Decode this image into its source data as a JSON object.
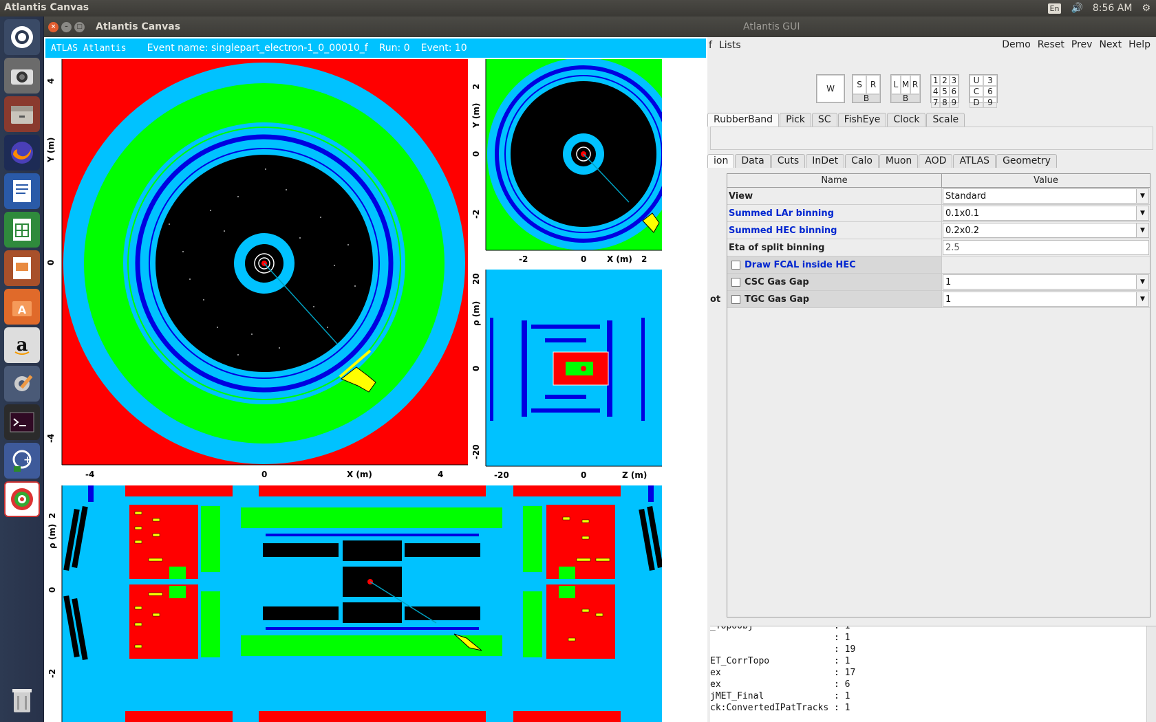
{
  "top_panel": {
    "title": "Atlantis Canvas",
    "keyboard": "En",
    "time": "8:56 AM"
  },
  "launcher": {
    "items": [
      "ubuntu-dash-icon",
      "camera-icon",
      "files-icon",
      "firefox-icon",
      "writer-icon",
      "calc-icon",
      "impress-icon",
      "software-center-icon",
      "amazon-icon",
      "settings-icon",
      "terminal-icon",
      "root-icon",
      "atlantis-icon",
      "trash-icon"
    ]
  },
  "canvas_window": {
    "title": "Atlantis Canvas",
    "header": {
      "logo": "ATLAS Atlantis",
      "event_name": "Event name: singlepart_electron-1_0_00010_f",
      "run": "Run: 0",
      "event": "Event: 10"
    },
    "yx_view": {
      "y_label": "Y (m)",
      "x_label": "X (m)",
      "y_ticks": [
        "4",
        "0",
        "-4"
      ],
      "x_ticks": [
        "-4",
        "0",
        "4"
      ]
    },
    "zoom_view": {
      "y_label": "Y (m)",
      "x_label": "X (m)",
      "y_ticks": [
        "2",
        "0",
        "-2"
      ],
      "x_ticks": [
        "-2",
        "0",
        "2"
      ]
    },
    "rz_view": {
      "y_label": "ρ (m)",
      "x_label": "Z (m)",
      "y_ticks": [
        "20",
        "0",
        "-20"
      ],
      "x_ticks": [
        "-20",
        "0"
      ]
    },
    "rz_zoom_view": {
      "y_label": "ρ (m)",
      "y_ticks": [
        "2",
        "0",
        "-2"
      ]
    },
    "colors": {
      "background_red": "#ff0000",
      "calo_green": "#00ff00",
      "cyan": "#00c2ff",
      "blue": "#0000e0",
      "track": "#00a0c0",
      "cluster_yellow": "#ffff00"
    }
  },
  "gui_window": {
    "title": "Atlantis GUI",
    "menu_left": [
      "f",
      "Lists"
    ],
    "menu_right": [
      "Demo",
      "Reset",
      "Prev",
      "Next",
      "Help"
    ],
    "window_buttons": {
      "w": "W",
      "s": "S",
      "r": "R",
      "b1": "B",
      "l": "L",
      "m": "M",
      "r2": "R",
      "b2": "B",
      "grid": [
        "1",
        "2",
        "3",
        "4",
        "5",
        "6",
        "7",
        "8",
        "9"
      ],
      "ucd": [
        "U",
        "3",
        "C",
        "6",
        "D",
        "9"
      ]
    },
    "tool_tabs": [
      "RubberBand",
      "Pick",
      "SC",
      "FishEye",
      "Clock",
      "Scale"
    ],
    "param_tabs": [
      "ion",
      "Data",
      "Cuts",
      "InDet",
      "Calo",
      "Muon",
      "AOD",
      "ATLAS",
      "Geometry"
    ],
    "table": {
      "col_name": "Name",
      "col_value": "Value",
      "rows": [
        {
          "name": "View",
          "value": "Standard"
        },
        {
          "name": "Summed LAr binning",
          "value": "0.1x0.1"
        },
        {
          "name": "Summed HEC binning",
          "value": "0.2x0.2"
        },
        {
          "name": "Eta of split binning",
          "value": "2.5"
        },
        {
          "name": "Draw FCAL inside HEC",
          "value": ""
        },
        {
          "name": "CSC Gas Gap",
          "value": "1"
        },
        {
          "name": "TGC Gas Gap",
          "value": "1"
        }
      ],
      "left_stub": "ot"
    },
    "output_lines": [
      {
        "key": "_TopoObj",
        "val": ": 1"
      },
      {
        "key": "",
        "val": ": 1"
      },
      {
        "key": "",
        "val": ": 19"
      },
      {
        "key": "ET_CorrTopo",
        "val": ": 1"
      },
      {
        "key": "ex",
        "val": ": 17"
      },
      {
        "key": "ex",
        "val": ": 6"
      },
      {
        "key": "jMET_Final",
        "val": ": 1"
      },
      {
        "key": "ck:ConvertedIPatTracks",
        "val": ": 1"
      }
    ]
  }
}
